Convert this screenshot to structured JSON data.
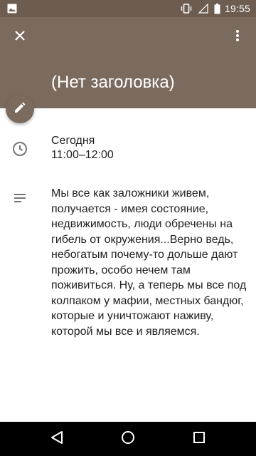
{
  "status_bar": {
    "time": "19:55",
    "icons": [
      "image-icon",
      "vibrate-icon",
      "signal-icon",
      "battery-icon"
    ]
  },
  "header": {
    "title": "(Нет заголовка)",
    "close_icon": "close-icon",
    "more_icon": "more-vert-icon",
    "edit_icon": "pencil-icon",
    "color": "#7b6b5e"
  },
  "event": {
    "day": "Сегодня",
    "time_range": "11:00–12:00",
    "description": "Мы все как заложники живем, получается - имея состояние, недвижимость, люди обречены на гибель от окружения...Верно ведь, небогатым почему-то дольше дают прожить, особо нечем там поживиться. Ну, а теперь мы все под колпаком у мафии, местных бандюг, которые и уничтожают наживу, которой мы все и являемся."
  },
  "nav_bar": {
    "icons": [
      "back-icon",
      "home-icon",
      "recents-icon"
    ]
  }
}
